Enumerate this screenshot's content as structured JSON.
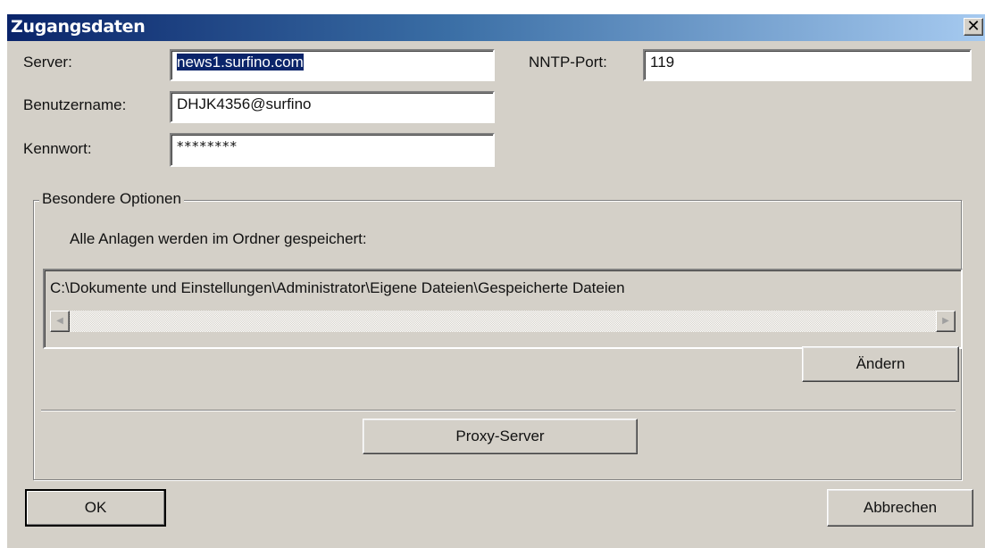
{
  "window": {
    "title": "Zugangsdaten",
    "close_glyph": "✕"
  },
  "form": {
    "server_label": "Server:",
    "server_value": "news1.surfino.com",
    "nntp_label": "NNTP-Port:",
    "nntp_value": "119",
    "username_label": "Benutzername:",
    "username_value": "DHJK4356@surfino",
    "password_label": "Kennwort:",
    "password_value": "********"
  },
  "options": {
    "group_label": "Besondere Optionen",
    "attachments_label": "Alle Anlagen werden im Ordner gespeichert:",
    "attachments_path": "C:\\Dokumente und Einstellungen\\Administrator\\Eigene Dateien\\Gespeicherte Dateien",
    "scroll_left_glyph": "◀",
    "scroll_right_glyph": "▶",
    "change_button": "Ändern",
    "proxy_button": "Proxy-Server"
  },
  "footer": {
    "ok_button": "OK",
    "cancel_button": "Abbrechen"
  },
  "colors": {
    "dialog_bg": "#d4d0c8",
    "title_gradient_start": "#0a246a",
    "title_gradient_end": "#a6caf0",
    "selection": "#0a246a"
  },
  "icons": {
    "close": "close-icon",
    "scroll_left": "scroll-left-arrow-icon",
    "scroll_right": "scroll-right-arrow-icon"
  }
}
